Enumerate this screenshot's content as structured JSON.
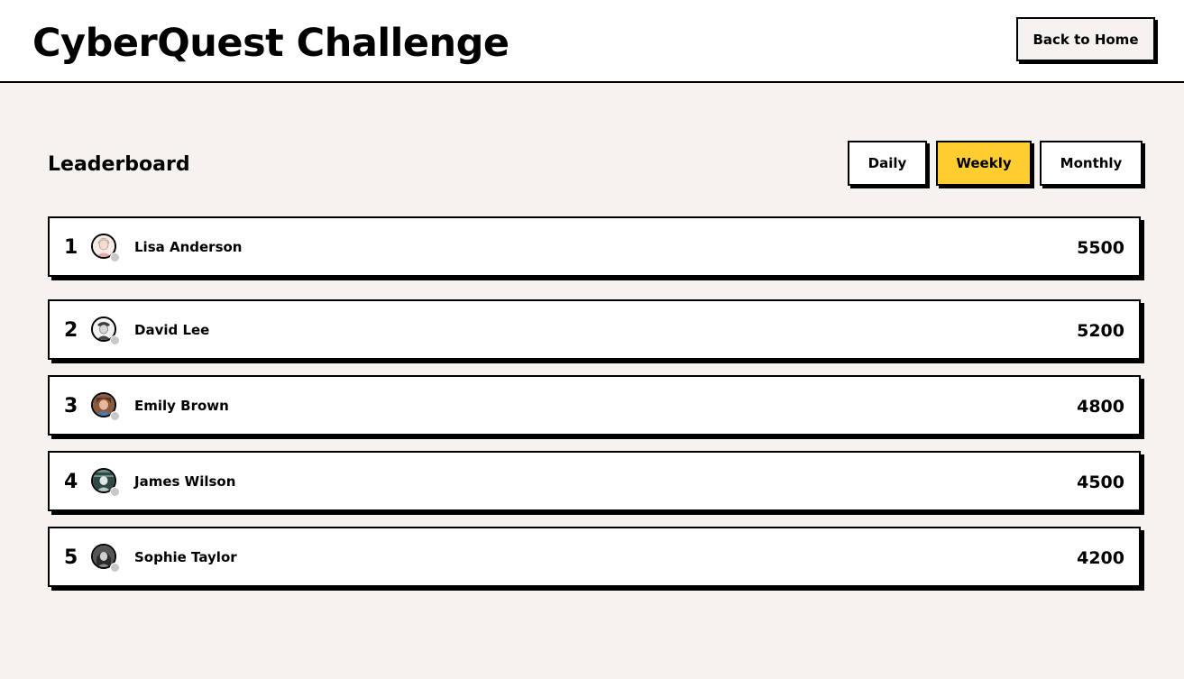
{
  "header": {
    "title": "CyberQuest Challenge",
    "back_label": "Back to Home"
  },
  "leaderboard": {
    "title": "Leaderboard",
    "periods": [
      {
        "label": "Daily",
        "active": false
      },
      {
        "label": "Weekly",
        "active": true
      },
      {
        "label": "Monthly",
        "active": false
      }
    ],
    "entries": [
      {
        "rank": "1",
        "name": "Lisa Anderson",
        "score": "5500",
        "avatar": "avatar-lisa-anderson-icon"
      },
      {
        "rank": "2",
        "name": "David Lee",
        "score": "5200",
        "avatar": "avatar-david-lee-icon"
      },
      {
        "rank": "3",
        "name": "Emily Brown",
        "score": "4800",
        "avatar": "avatar-emily-brown-icon"
      },
      {
        "rank": "4",
        "name": "James Wilson",
        "score": "4500",
        "avatar": "avatar-james-wilson-icon"
      },
      {
        "rank": "5",
        "name": "Sophie Taylor",
        "score": "4200",
        "avatar": "avatar-sophie-taylor-icon"
      }
    ]
  },
  "colors": {
    "background": "#f5f2ef",
    "active_tab": "#fecd2f",
    "card": "#ffffff",
    "border": "#000000",
    "status_offline": "#c8c8c8"
  }
}
